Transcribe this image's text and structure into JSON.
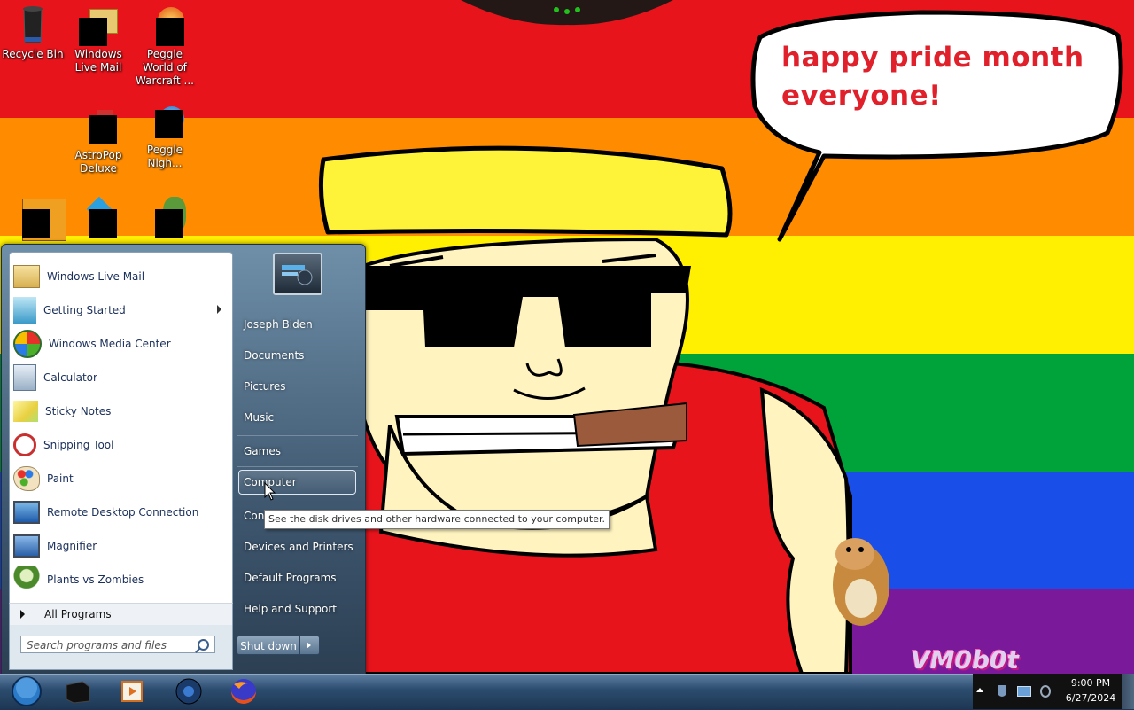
{
  "wallpaper": {
    "speech_line1": "happy pride month",
    "speech_line2": "everyone!",
    "watermark": "VM0b0t",
    "stripe_colors": [
      "#e8141c",
      "#ff8c00",
      "#ffef00",
      "#00a23a",
      "#1a4ee8",
      "#7a1a9a"
    ]
  },
  "desktop_icons": [
    {
      "label": "Recycle Bin",
      "icon": "recycle-bin-icon"
    },
    {
      "label": "Windows Live Mail",
      "icon": "windows-live-mail-icon"
    },
    {
      "label": "Peggle World of Warcraft ...",
      "icon": "peggle-wow-icon"
    },
    {
      "label": "AstroPop Deluxe",
      "icon": "astropop-icon"
    },
    {
      "label": "Peggle Nigh...",
      "icon": "peggle-nights-icon"
    },
    {
      "label": "",
      "icon": "bejeweled-icon"
    },
    {
      "label": "",
      "icon": "game-icon"
    },
    {
      "label": "",
      "icon": "plants-icon"
    }
  ],
  "start_menu": {
    "programs": [
      {
        "label": "Windows Live Mail",
        "icon": "windows-live-mail-icon",
        "submenu": false
      },
      {
        "label": "Getting Started",
        "icon": "getting-started-icon",
        "submenu": true
      },
      {
        "label": "Windows Media Center",
        "icon": "windows-media-center-icon",
        "submenu": false
      },
      {
        "label": "Calculator",
        "icon": "calculator-icon",
        "submenu": false
      },
      {
        "label": "Sticky Notes",
        "icon": "sticky-notes-icon",
        "submenu": false
      },
      {
        "label": "Snipping Tool",
        "icon": "snipping-tool-icon",
        "submenu": false
      },
      {
        "label": "Paint",
        "icon": "paint-icon",
        "submenu": false
      },
      {
        "label": "Remote Desktop Connection",
        "icon": "remote-desktop-icon",
        "submenu": false
      },
      {
        "label": "Magnifier",
        "icon": "magnifier-icon",
        "submenu": false
      },
      {
        "label": "Plants vs Zombies",
        "icon": "plants-vs-zombies-icon",
        "submenu": false
      }
    ],
    "all_programs": "All Programs",
    "search_placeholder": "Search programs and files",
    "right_links": {
      "user": "Joseph Biden",
      "documents": "Documents",
      "pictures": "Pictures",
      "music": "Music",
      "games": "Games",
      "computer": "Computer",
      "control_panel": "Con",
      "devices": "Devices and Printers",
      "default_programs": "Default Programs",
      "help": "Help and Support"
    },
    "shutdown": "Shut down",
    "tooltip": "See the disk drives and other hardware connected to your computer."
  },
  "taskbar": {
    "pinned": [
      "windows-media-player-icon",
      "media-center-icon",
      "firefox-icon"
    ],
    "time": "9:00 PM",
    "date": "6/27/2024"
  }
}
